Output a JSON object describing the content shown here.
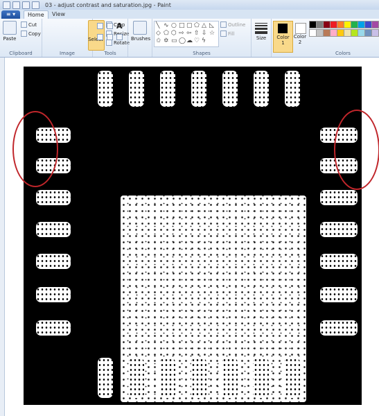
{
  "window": {
    "title": "03 - adjust contrast and saturation.jpg - Paint"
  },
  "tabs": {
    "app_menu": "≡ ▾",
    "home": "Home",
    "view": "View"
  },
  "clipboard": {
    "paste": "Paste",
    "cut": "Cut",
    "copy": "Copy",
    "label": "Clipboard"
  },
  "image": {
    "select": "Select",
    "crop": "Crop",
    "resize": "Resize",
    "rotate": "Rotate",
    "label": "Image"
  },
  "tools": {
    "label": "Tools"
  },
  "brushes": {
    "label": "Brushes"
  },
  "shapes": {
    "outline": "Outline",
    "fill": "Fill",
    "label": "Shapes"
  },
  "size": {
    "label": "Size"
  },
  "colors": {
    "color1": "Color\n1",
    "color2": "Color\n2",
    "label": "Colors",
    "palette": [
      "#000000",
      "#7f7f7f",
      "#880015",
      "#ed1c24",
      "#ff7f27",
      "#fff200",
      "#22b14c",
      "#00a2e8",
      "#3f48cc",
      "#a349a4",
      "#ffffff",
      "#c3c3c3",
      "#b97a57",
      "#ffaec9",
      "#ffc90e",
      "#efe4b0",
      "#b5e61d",
      "#99d9ea",
      "#7092be",
      "#c8bfe7"
    ]
  },
  "annotations": {
    "circle_color": "#c0262b"
  }
}
